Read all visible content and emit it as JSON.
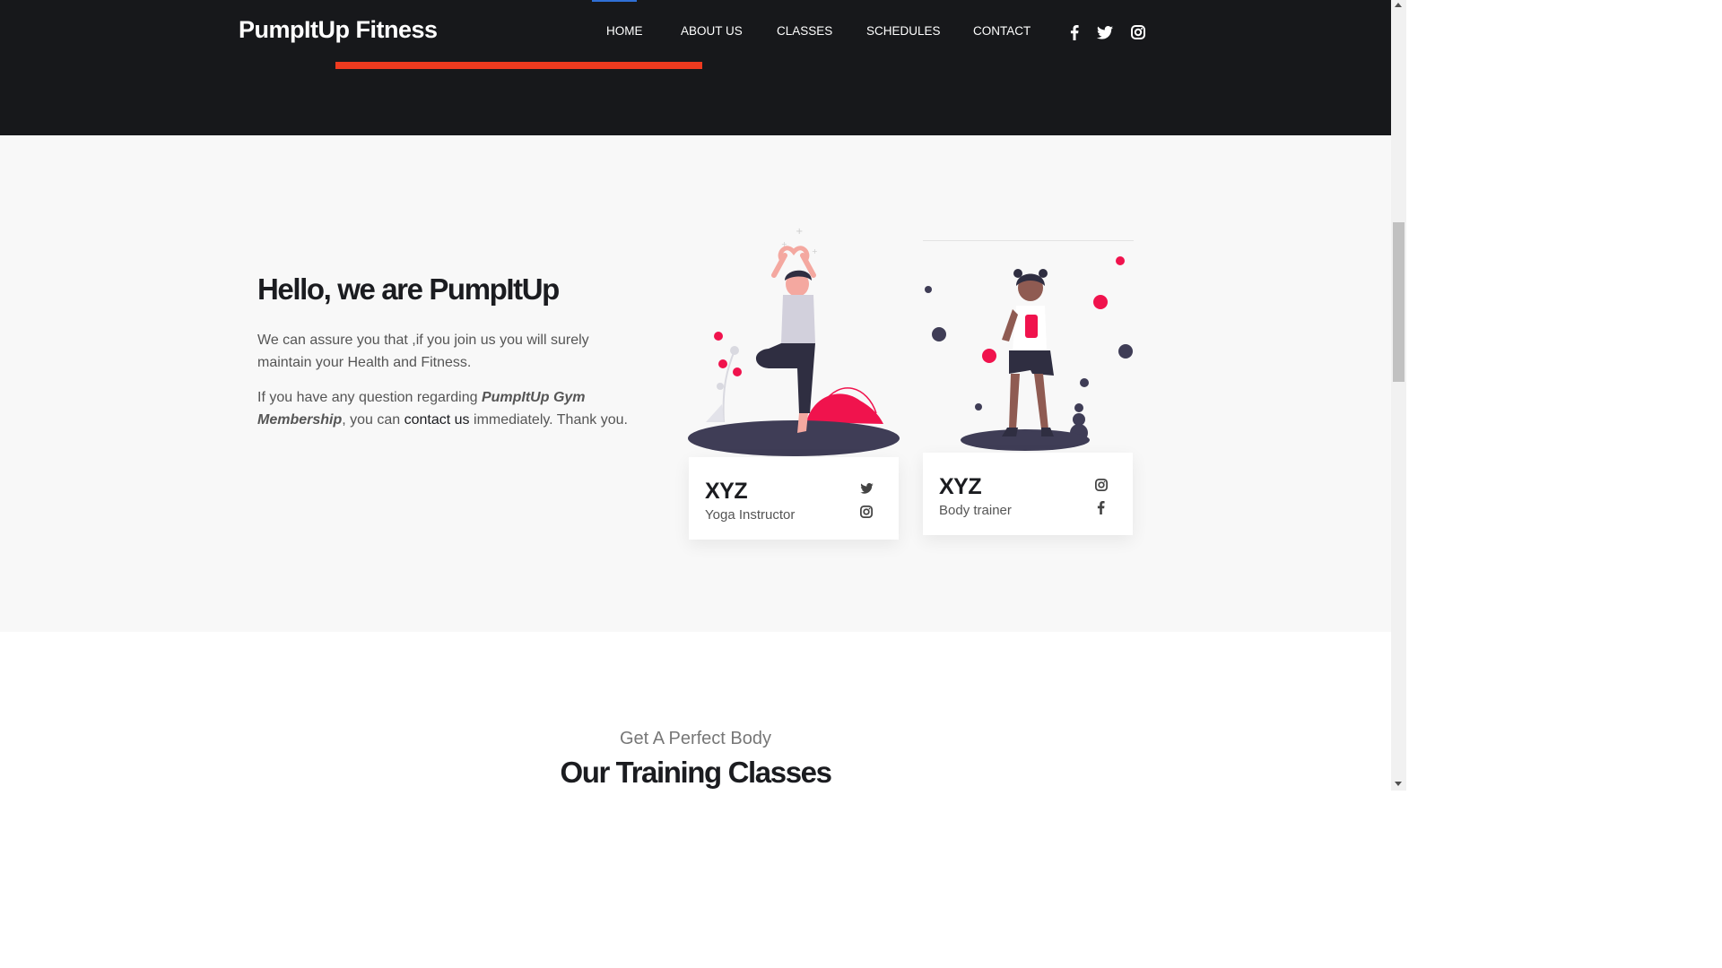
{
  "header": {
    "logo": "PumpItUp Fitness",
    "nav": [
      {
        "label": "HOME",
        "active": true
      },
      {
        "label": "ABOUT US",
        "active": false
      },
      {
        "label": "CLASSES",
        "active": false
      },
      {
        "label": "SCHEDULES",
        "active": false
      },
      {
        "label": "CONTACT",
        "active": false
      }
    ],
    "social_icons": [
      "facebook-icon",
      "twitter-icon",
      "instagram-icon"
    ]
  },
  "about": {
    "title": "Hello, we are PumpItUp",
    "p1": "We can assure you that ,if you join us you will surely maintain your Health and Fitness.",
    "p2_before": "If you have any question regarding ",
    "p2_strong": "PumpItUp Gym Membership",
    "p2_mid": ", you can ",
    "p2_link": "contact us",
    "p2_after": " immediately. Thank you."
  },
  "trainers": [
    {
      "name": "XYZ",
      "role": "Yoga Instructor",
      "icons": [
        "twitter-icon",
        "instagram-icon"
      ]
    },
    {
      "name": "XYZ",
      "role": "Body trainer",
      "icons": [
        "instagram-icon",
        "facebook-icon"
      ]
    }
  ],
  "classes": {
    "subtitle": "Get A Perfect Body",
    "title": "Our Training Classes"
  },
  "colors": {
    "header_bg": "#17181b",
    "accent_red": "#ee3a1f",
    "pink": "#f0134d",
    "dark_text": "#1b1c20"
  }
}
